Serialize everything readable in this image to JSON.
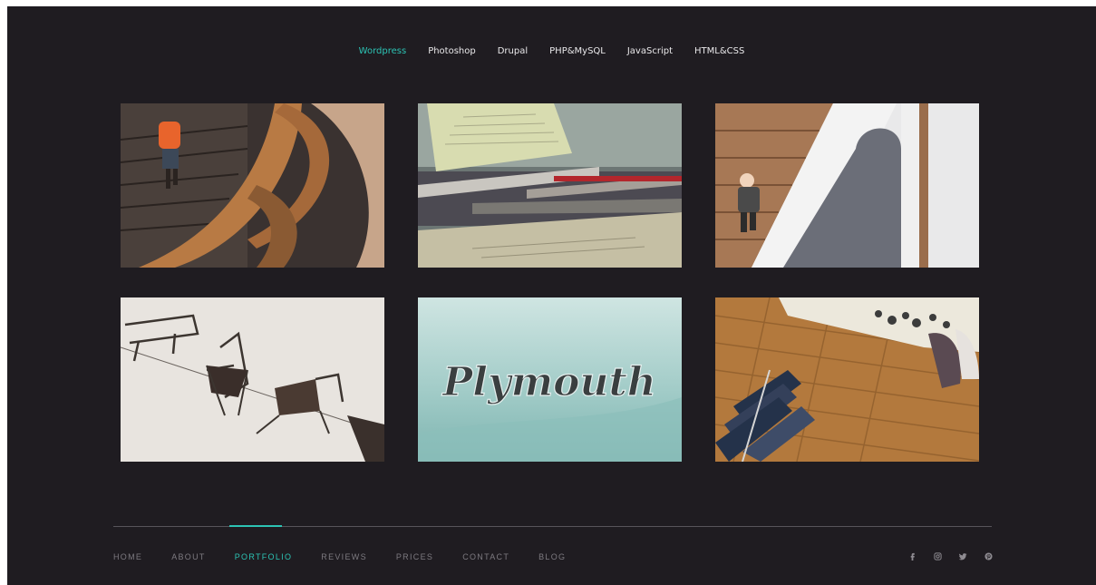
{
  "filters": {
    "items": [
      "Wordpress",
      "Photoshop",
      "Drupal",
      "PHP&MySQL",
      "JavaScript",
      "HTML&CSS"
    ],
    "active_index": 0
  },
  "portfolio": {
    "tiles": [
      "spiral-staircase-photo",
      "pens-on-desk-photo",
      "man-on-staircase-photo",
      "hanging-chairs-photo",
      "plymouth-emblem-photo",
      "clothing-rack-photo"
    ]
  },
  "footer_nav": {
    "items": [
      "HOME",
      "ABOUT",
      "PORTFOLIO",
      "REVIEWS",
      "PRICES",
      "CONTACT",
      "BLOG"
    ],
    "active_index": 2
  },
  "social": [
    "facebook-icon",
    "instagram-icon",
    "twitter-icon",
    "pinterest-icon"
  ],
  "colors": {
    "background": "#1f1c21",
    "accent": "#2cc3b4",
    "nav_text": "#7d7a80"
  },
  "tile_text": {
    "plymouth": "Plymouth"
  }
}
